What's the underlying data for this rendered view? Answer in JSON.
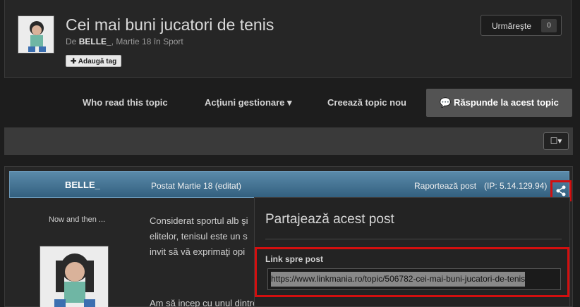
{
  "topic": {
    "title": "Cei mai buni jucatori de tenis",
    "by_prefix": "De",
    "author": "BELLE_",
    "date_category": ", Martie 18 în Sport",
    "add_tag": "✚ Adaugă tag",
    "follow_label": "Urmăreşte",
    "follow_count": "0"
  },
  "actions": {
    "who_read": "Who read this topic",
    "manage": "Acţiuni gestionare ▾",
    "new_topic": "Creează topic nou",
    "reply": "Răspunde la acest topic"
  },
  "toolbar": {
    "select_label": "☐▾"
  },
  "post": {
    "author": "BELLE_",
    "posted": "Postat Martie 18 (editat)",
    "report": "Raportează post",
    "ip": "(IP: 5.14.129.94)",
    "motto": "Now and then ...",
    "lines": [
      "Considerat sportul alb şi",
      "elitelor, tenisul este un s",
      "invit să vă exprimaţi opi",
      "Am să incep cu unul dintre preferaţii mei."
    ]
  },
  "share": {
    "title": "Partajează acest post",
    "link_label": "Link spre post",
    "url": "https://www.linkmania.ro/topic/506782-cei-mai-buni-jucatori-de-tenis"
  },
  "colors": {
    "accent_red": "#d30f0f",
    "post_bar": "#4a7a9a"
  }
}
